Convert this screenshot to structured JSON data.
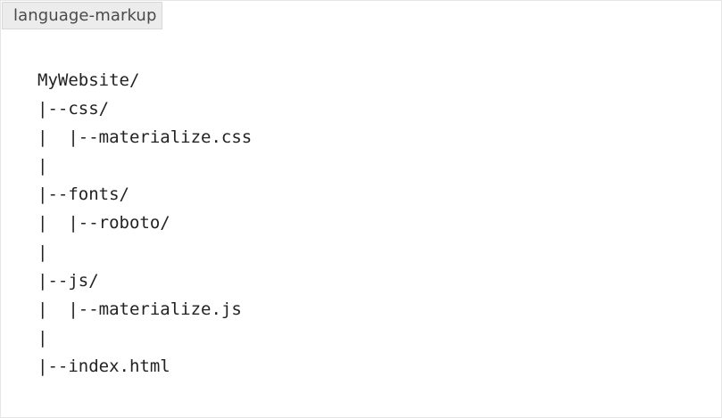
{
  "code_block": {
    "language_label": "language-markup",
    "lines": [
      "MyWebsite/",
      "|--css/",
      "|  |--materialize.css",
      "|",
      "|--fonts/",
      "|  |--roboto/",
      "|",
      "|--js/",
      "|  |--materialize.js",
      "|",
      "|--index.html"
    ]
  }
}
